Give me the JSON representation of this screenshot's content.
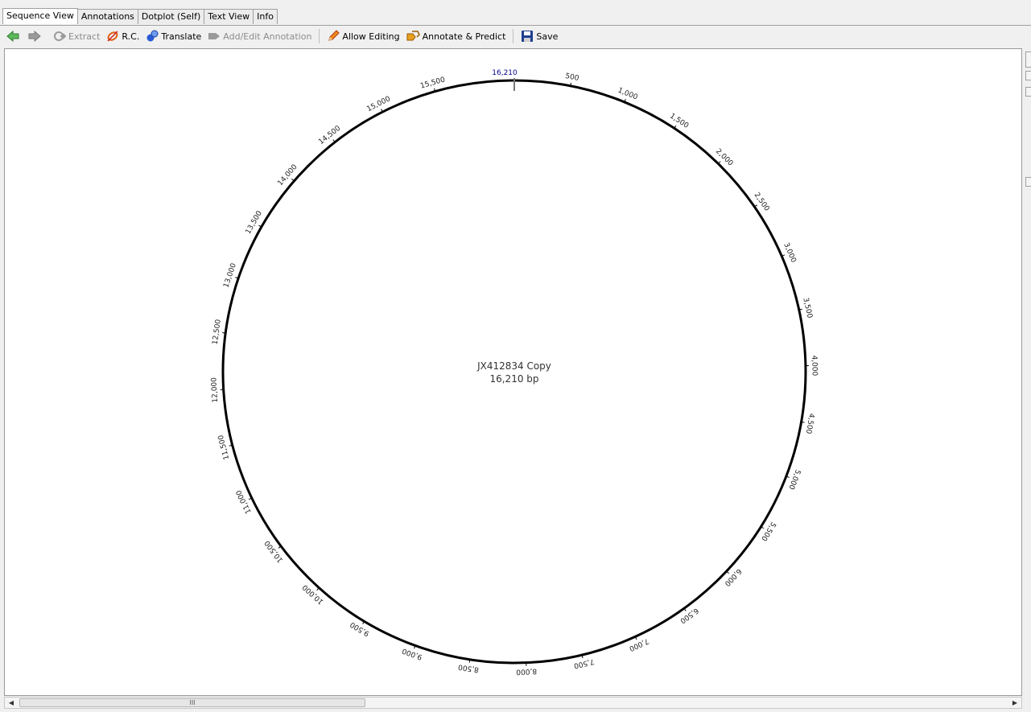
{
  "tabs": [
    {
      "label": "Sequence View",
      "active": true
    },
    {
      "label": "Annotations",
      "active": false
    },
    {
      "label": "Dotplot (Self)",
      "active": false
    },
    {
      "label": "Text View",
      "active": false
    },
    {
      "label": "Info",
      "active": false
    }
  ],
  "toolbar": {
    "back_icon": "back-arrow-icon",
    "forward_icon": "forward-arrow-icon",
    "extract": "Extract",
    "rc": "R.C.",
    "translate": "Translate",
    "add_edit_annotation": "Add/Edit Annotation",
    "allow_editing": "Allow Editing",
    "annotate_predict": "Annotate & Predict",
    "save": "Save"
  },
  "map": {
    "name": "JX412834 Copy",
    "length_label": "16,210 bp",
    "total_bp": 16210,
    "origin_label": "16,210",
    "origin_color": "#00008b",
    "ticks": [
      "500",
      "1,000",
      "1,500",
      "2,000",
      "2,500",
      "3,000",
      "3,500",
      "4,000",
      "4,500",
      "5,000",
      "5,500",
      "6,000",
      "6,500",
      "7,000",
      "7,500",
      "8,000",
      "8,500",
      "9,000",
      "9,500",
      "10,000",
      "10,500",
      "11,000",
      "11,500",
      "12,000",
      "12,500",
      "13,000",
      "13,500",
      "14,000",
      "14,500",
      "15,000",
      "15,500"
    ],
    "tick_positions": [
      500,
      1000,
      1500,
      2000,
      2500,
      3000,
      3500,
      4000,
      4500,
      5000,
      5500,
      6000,
      6500,
      7000,
      7500,
      8000,
      8500,
      9000,
      9500,
      10000,
      10500,
      11000,
      11500,
      12000,
      12500,
      13000,
      13500,
      14000,
      14500,
      15000,
      15500
    ]
  },
  "scrollbar": {
    "thumb_grip": "III"
  }
}
